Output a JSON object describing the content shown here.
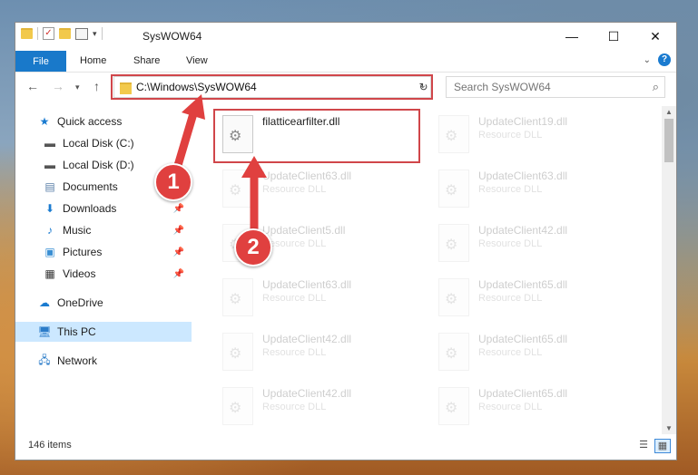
{
  "window": {
    "title": "SysWOW64",
    "controls": {
      "minimize": "—",
      "maximize": "☐",
      "close": "✕"
    }
  },
  "ribbon": {
    "tabs": [
      "File",
      "Home",
      "Share",
      "View"
    ]
  },
  "address_bar": {
    "path": "C:\\Windows\\SysWOW64",
    "search_placeholder": "Search SysWOW64"
  },
  "sidebar": {
    "items": [
      {
        "label": "Quick access",
        "icon": "star-icon",
        "pinned": false
      },
      {
        "label": "Local Disk (C:)",
        "icon": "drive-icon",
        "pinned": false
      },
      {
        "label": "Local Disk (D:)",
        "icon": "drive-icon",
        "pinned": false
      },
      {
        "label": "Documents",
        "icon": "document-icon",
        "pinned": true
      },
      {
        "label": "Downloads",
        "icon": "download-icon",
        "pinned": true
      },
      {
        "label": "Music",
        "icon": "music-icon",
        "pinned": true
      },
      {
        "label": "Pictures",
        "icon": "pictures-icon",
        "pinned": true
      },
      {
        "label": "Videos",
        "icon": "video-icon",
        "pinned": true
      },
      {
        "label": "OneDrive",
        "icon": "cloud-icon",
        "pinned": false
      },
      {
        "label": "This PC",
        "icon": "computer-icon",
        "pinned": false,
        "selected": true
      },
      {
        "label": "Network",
        "icon": "network-icon",
        "pinned": false
      }
    ]
  },
  "files": [
    {
      "name": "filatticearfilter.dll",
      "type": "",
      "highlighted": true
    },
    {
      "name": "UpdateClient19.dll",
      "type": "Resource DLL"
    },
    {
      "name": "UpdateClient63.dll",
      "type": "Resource DLL"
    },
    {
      "name": "UpdateClient63.dll",
      "type": "Resource DLL"
    },
    {
      "name": "UpdateClient5.dll",
      "type": "Resource DLL"
    },
    {
      "name": "UpdateClient42.dll",
      "type": "Resource DLL"
    },
    {
      "name": "UpdateClient63.dll",
      "type": "Resource DLL"
    },
    {
      "name": "UpdateClient65.dll",
      "type": "Resource DLL"
    },
    {
      "name": "UpdateClient42.dll",
      "type": "Resource DLL"
    },
    {
      "name": "UpdateClient65.dll",
      "type": "Resource DLL"
    },
    {
      "name": "UpdateClient42.dll",
      "type": "Resource DLL"
    },
    {
      "name": "UpdateClient65.dll",
      "type": "Resource DLL"
    }
  ],
  "status": {
    "count": "146 items"
  },
  "annotations": {
    "step1": "1",
    "step2": "2",
    "color": "#e0403f"
  }
}
